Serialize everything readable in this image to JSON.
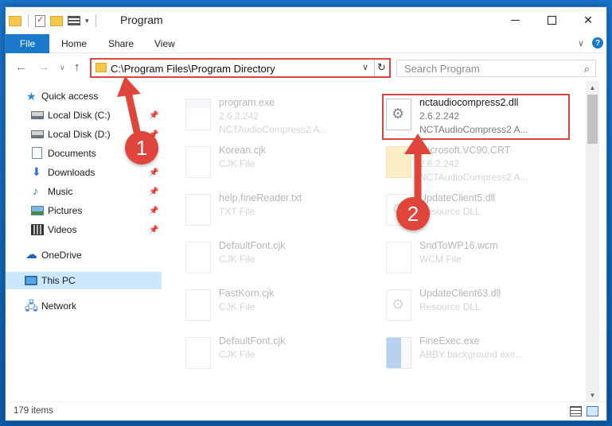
{
  "window": {
    "title": "Program"
  },
  "ribbon": {
    "tabs": [
      "File",
      "Home",
      "Share",
      "View"
    ]
  },
  "address": {
    "path": "C:\\Program Files\\Program Directory"
  },
  "search": {
    "placeholder": "Search Program"
  },
  "navpane": {
    "items": [
      {
        "label": "Quick access",
        "icon": "star-icon"
      },
      {
        "label": "Local Disk (C:)",
        "icon": "drive-icon",
        "pinned": true
      },
      {
        "label": "Local Disk (D:)",
        "icon": "drive-icon",
        "pinned": true
      },
      {
        "label": "Documents",
        "icon": "documents-icon",
        "pinned": true
      },
      {
        "label": "Downloads",
        "icon": "download-icon",
        "pinned": true
      },
      {
        "label": "Music",
        "icon": "music-icon",
        "pinned": true
      },
      {
        "label": "Pictures",
        "icon": "pictures-icon",
        "pinned": true
      },
      {
        "label": "Videos",
        "icon": "videos-icon",
        "pinned": true
      },
      {
        "label": "OneDrive",
        "icon": "cloud-icon"
      },
      {
        "label": "This PC",
        "icon": "computer-icon",
        "selected": true
      },
      {
        "label": "Network",
        "icon": "network-icon"
      }
    ]
  },
  "files": {
    "left": [
      {
        "name": "program.exe",
        "line2": "2.6.2.242",
        "line3": "NCTAudioCompress2 A..."
      },
      {
        "name": "Korean.cjk",
        "line2": "CJK File"
      },
      {
        "name": "help.fineReader.txt",
        "line2": "TXT File"
      },
      {
        "name": "DefaultFont.cjk",
        "line2": "CJK File"
      },
      {
        "name": "FastKorn.cjk",
        "line2": "CJK File"
      },
      {
        "name": "DefaultFont.cjk",
        "line2": "CJK File"
      }
    ],
    "right": [
      {
        "name": "nctaudiocompress2.dll",
        "line2": "2.6.2.242",
        "line3": "NCTAudioCompress2 A..."
      },
      {
        "name": "Microsoft.VC90.CRT",
        "line2": "2.6.2.242",
        "line3": "NCTAudioCompress2 A..."
      },
      {
        "name": "UpdateClient5.dll",
        "line2": "Resource DLL"
      },
      {
        "name": "SndToWP16.wcm",
        "line2": "WCM File"
      },
      {
        "name": "UpdateClient63.dll",
        "line2": "Resource DLL"
      },
      {
        "name": "FineExec.exe",
        "line2": "ABBY background exe..."
      }
    ]
  },
  "status": {
    "item_count": "179 items"
  },
  "annotations": {
    "step1": "1",
    "step2": "2",
    "color": "#e0453b"
  }
}
